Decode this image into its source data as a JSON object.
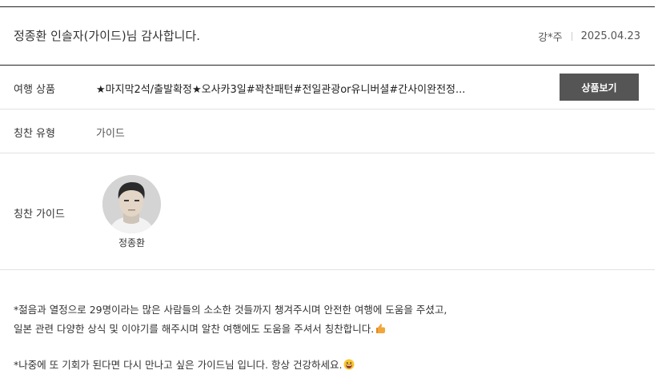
{
  "review": {
    "title": "정종환 인솔자(가이드)님 감사합니다.",
    "author": "강*주",
    "date": "2025.04.23"
  },
  "details": {
    "product_label": "여행 상품",
    "product_value": "★마지막2석/출발확정★오사카3일#꽉찬패턴#전일관광or유니버셜#간사이완전정...",
    "product_button": "상품보기",
    "type_label": "칭찬 유형",
    "type_value": "가이드",
    "guide_label": "칭찬 가이드",
    "guide_name": "정종환"
  },
  "content": {
    "line1": "*젊음과 열정으로 29명이라는 많은 사람들의 소소한 것들까지 챙겨주시며 안전한 여행에 도움을 주셨고,",
    "line2": "일본 관련 다양한 상식 및 이야기를 해주시며 알찬 여행에도 도움을 주셔서 칭찬합니다.",
    "line3": "*나중에 또 기회가 된다면 다시 만나고 싶은 가이드님 입니다. 항상 건강하세요."
  },
  "icons": {
    "line2_end": "thumbs-up-emoji",
    "line3_end": "grinning-face-emoji"
  },
  "colors": {
    "button_bg": "#555555",
    "border_dark": "#222222",
    "border_light": "#e2e2e2"
  }
}
